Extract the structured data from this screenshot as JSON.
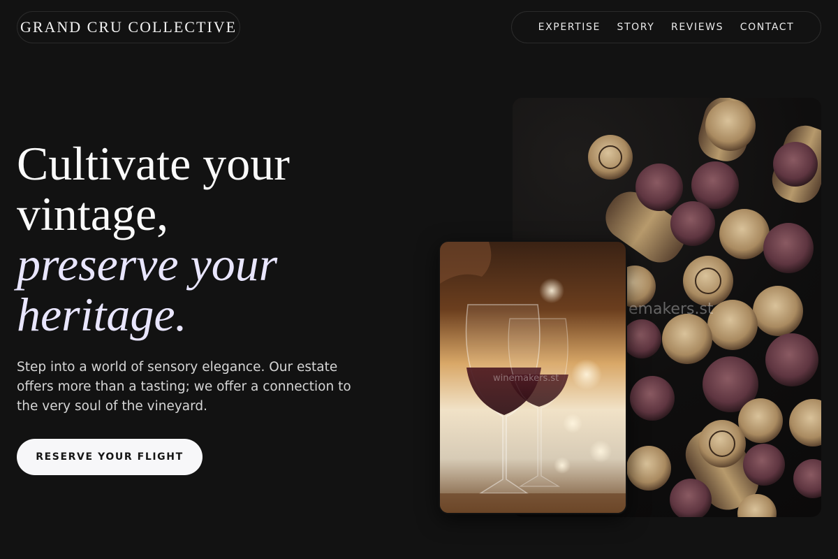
{
  "brand": {
    "name": "GRAND CRU COLLECTIVE"
  },
  "nav": {
    "items": [
      "EXPERTISE",
      "STORY",
      "REVIEWS",
      "CONTACT"
    ]
  },
  "hero": {
    "title_lines": [
      "Cultivate your",
      "vintage,",
      "preserve your",
      "heritage."
    ],
    "description": "Step into a world of sensory elegance. Our estate offers more than a tasting; we offer a connection to the very soul of the vineyard.",
    "cta_label": "RESERVE YOUR FLIGHT"
  },
  "images": {
    "corks_watermark": "emakers.st",
    "glasses_watermark": "winemakers.st"
  },
  "colors": {
    "background": "#121212",
    "accent_text": "#e9e6ff",
    "cta_background": "#f7f7f9"
  }
}
